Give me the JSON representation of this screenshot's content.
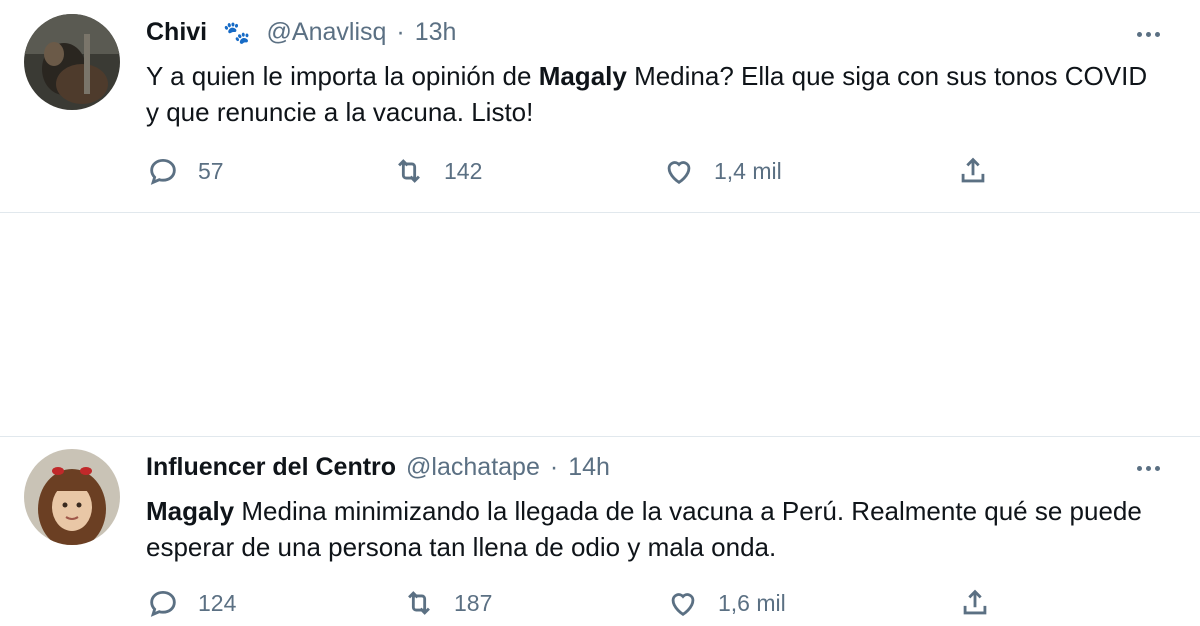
{
  "tweets": [
    {
      "name": "Chivi",
      "handle": "@Anavlisq",
      "separator": "·",
      "time": "13h",
      "text_bold": "Magaly",
      "text_before": "Y a quien le importa la opinión de ",
      "text_after": " Medina? Ella que siga con sus tonos COVID y que renuncie a la vacuna. Listo!",
      "replies": "57",
      "retweets": "142",
      "likes": "1,4 mil",
      "name_emoji": "🐾"
    },
    {
      "name": "Influencer del Centro",
      "handle": "@lachatape",
      "separator": "·",
      "time": "14h",
      "text_bold": "Magaly",
      "text_before": "",
      "text_after": " Medina minimizando la llegada de la vacuna a Perú. Realmente qué se puede esperar de una persona tan llena de odio y mala onda.",
      "replies": "124",
      "retweets": "187",
      "likes": "1,6 mil"
    }
  ],
  "icons": {
    "reply": "reply-icon",
    "retweet": "retweet-icon",
    "like": "like-icon",
    "share": "share-icon",
    "more": "more-icon"
  },
  "colors": {
    "text": "#0f1419",
    "muted": "#5b7083",
    "divider": "#e1e8ed"
  }
}
